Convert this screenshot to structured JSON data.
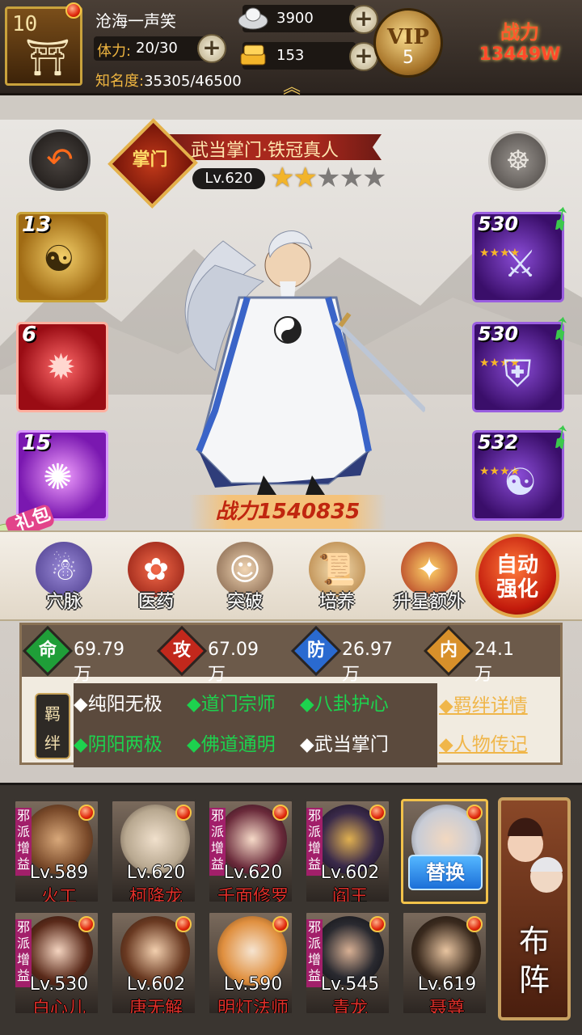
{
  "player": {
    "level": "10",
    "name": "沧海一声笑",
    "stamina_label": "体力:",
    "stamina": "20/30",
    "fame_label": "知名度:",
    "fame": "35305/46500"
  },
  "resources": {
    "silver": "3900",
    "gold": "153"
  },
  "vip": {
    "label": "VIP",
    "level": "5"
  },
  "top_power": {
    "label": "战力",
    "value": "13449W"
  },
  "hero": {
    "title": "武当掌门·铁冠真人",
    "seal": "掌门",
    "level": "Lv.620",
    "stars_filled": 2,
    "stars_total": 5,
    "power": "战力1540835"
  },
  "skills": [
    "13",
    "6",
    "15"
  ],
  "equipment": [
    "530",
    "530",
    "532"
  ],
  "gift_label": "礼包",
  "actions": [
    {
      "label": "穴脉"
    },
    {
      "label": "医药"
    },
    {
      "label": "突破"
    },
    {
      "label": "培养"
    },
    {
      "label": "升星额外"
    }
  ],
  "auto_button": {
    "line1": "自动",
    "line2": "强化"
  },
  "stats": [
    {
      "char": "命",
      "value": "69.79万",
      "color": "#1f9e38"
    },
    {
      "char": "攻",
      "value": "67.09万",
      "color": "#c2281c"
    },
    {
      "char": "防",
      "value": "26.97万",
      "color": "#2a6ad0"
    },
    {
      "char": "内",
      "value": "24.1万",
      "color": "#d8902a"
    }
  ],
  "bond_tag": {
    "line1": "羁",
    "line2": "绊"
  },
  "bonds": [
    {
      "text": "◆纯阳无极",
      "active": false
    },
    {
      "text": "◆道门宗师",
      "active": true
    },
    {
      "text": "◆八卦护心",
      "active": true
    },
    {
      "text": "◆阴阳两极",
      "active": true
    },
    {
      "text": "◆佛道通明",
      "active": true
    },
    {
      "text": "◆武当掌门",
      "active": false
    }
  ],
  "links": {
    "bond_detail": "◆羁绊详情",
    "biography": "◆人物传记"
  },
  "team": [
    {
      "level": "Lv.589",
      "name": "火工",
      "tag": "邪派增益"
    },
    {
      "level": "Lv.620",
      "name": "柯降龙",
      "tag": ""
    },
    {
      "level": "Lv.620",
      "name": "千面修罗",
      "tag": "邪派增益"
    },
    {
      "level": "Lv.602",
      "name": "阎王",
      "tag": "邪派增益"
    },
    {
      "level": "",
      "name": "",
      "tag": "",
      "swap": "替换"
    },
    {
      "level": "Lv.530",
      "name": "白心儿",
      "tag": "邪派增益"
    },
    {
      "level": "Lv.602",
      "name": "唐无解",
      "tag": ""
    },
    {
      "level": "Lv.590",
      "name": "明灯法师",
      "tag": ""
    },
    {
      "level": "Lv.545",
      "name": "青龙",
      "tag": "邪派增益"
    },
    {
      "level": "Lv.619",
      "name": "聂尊",
      "tag": ""
    }
  ],
  "formation": {
    "line1": "布",
    "line2": "阵"
  }
}
